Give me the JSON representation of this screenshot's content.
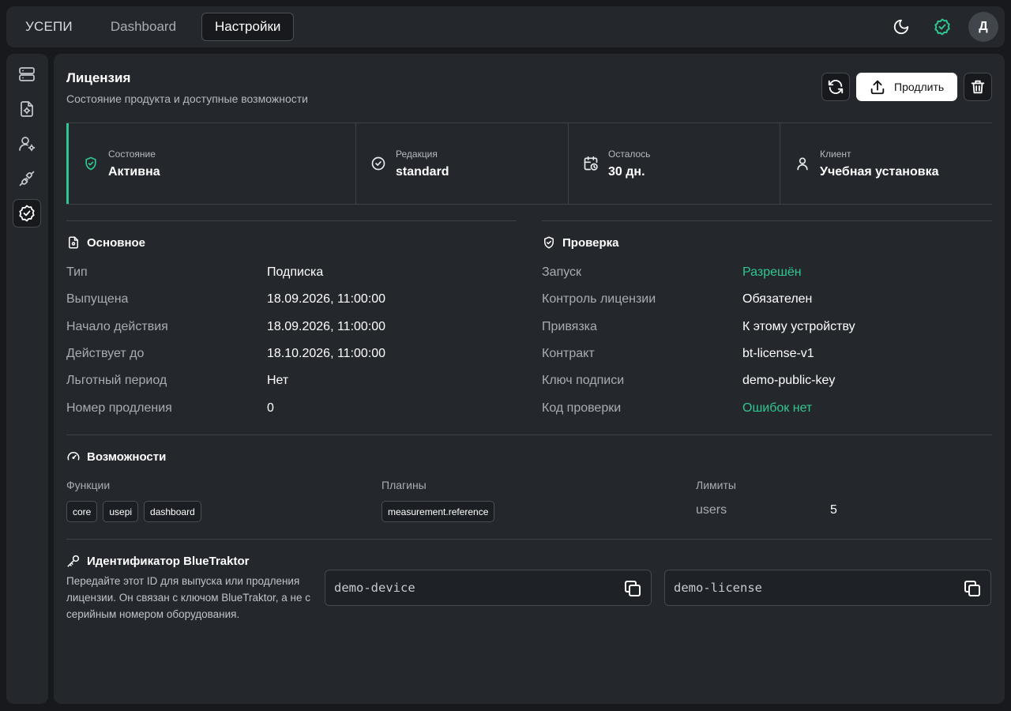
{
  "topbar": {
    "brand": "УСЕПИ",
    "tabs": [
      {
        "label": "Dashboard",
        "active": false
      },
      {
        "label": "Настройки",
        "active": true
      }
    ],
    "avatar_letter": "Д",
    "icons": [
      "moon-icon",
      "shield-check-icon"
    ]
  },
  "sidebar": {
    "items": [
      {
        "icon": "server-icon",
        "active": false
      },
      {
        "icon": "file-settings-icon",
        "active": false
      },
      {
        "icon": "user-settings-icon",
        "active": false
      },
      {
        "icon": "plug-icon",
        "active": false
      },
      {
        "icon": "badge-check-icon",
        "active": true
      }
    ]
  },
  "license": {
    "title": "Лицензия",
    "subtitle": "Состояние продукта и доступные возможности",
    "renew_label": "Продлить",
    "stats": [
      {
        "label": "Состояние",
        "value": "Активна",
        "icon": "shield-check-icon"
      },
      {
        "label": "Редакция",
        "value": "standard",
        "icon": "circle-check-icon"
      },
      {
        "label": "Осталось",
        "value": "30 дн.",
        "icon": "calendar-clock-icon"
      },
      {
        "label": "Клиент",
        "value": "Учебная установка",
        "icon": "user-icon"
      }
    ]
  },
  "basic": {
    "title": "Основное",
    "rows": [
      {
        "label": "Тип",
        "value": "Подписка"
      },
      {
        "label": "Выпущена",
        "value": "18.09.2026, 11:00:00"
      },
      {
        "label": "Начало действия",
        "value": "18.09.2026, 11:00:00"
      },
      {
        "label": "Действует до",
        "value": "18.10.2026, 11:00:00"
      },
      {
        "label": "Льготный период",
        "value": "Нет"
      },
      {
        "label": "Номер продления",
        "value": "0"
      }
    ]
  },
  "check": {
    "title": "Проверка",
    "rows": [
      {
        "label": "Запуск",
        "value": "Разрешён",
        "status": "ok"
      },
      {
        "label": "Контроль лицензии",
        "value": "Обязателен"
      },
      {
        "label": "Привязка",
        "value": "К этому устройству"
      },
      {
        "label": "Контракт",
        "value": "bt-license-v1"
      },
      {
        "label": "Ключ подписи",
        "value": "demo-public-key"
      },
      {
        "label": "Код проверки",
        "value": "Ошибок нет",
        "status": "ok"
      }
    ]
  },
  "capabilities": {
    "title": "Возможности",
    "functions_label": "Функции",
    "functions": [
      "core",
      "usepi",
      "dashboard"
    ],
    "plugins_label": "Плагины",
    "plugins": [
      "measurement.reference"
    ],
    "limits_label": "Лимиты",
    "limits": [
      {
        "name": "users",
        "value": "5"
      }
    ]
  },
  "identifier": {
    "title": "Идентификатор BlueTraktor",
    "description": "Передайте этот ID для выпуска или продления лицензии. Он связан с ключом BlueTraktor, а не с серийным номером оборудования.",
    "device_id": "demo-device",
    "license_id": "demo-license"
  },
  "colors": {
    "accent_green": "#2fc78f",
    "background": "#17191c",
    "panel": "#24282d"
  }
}
